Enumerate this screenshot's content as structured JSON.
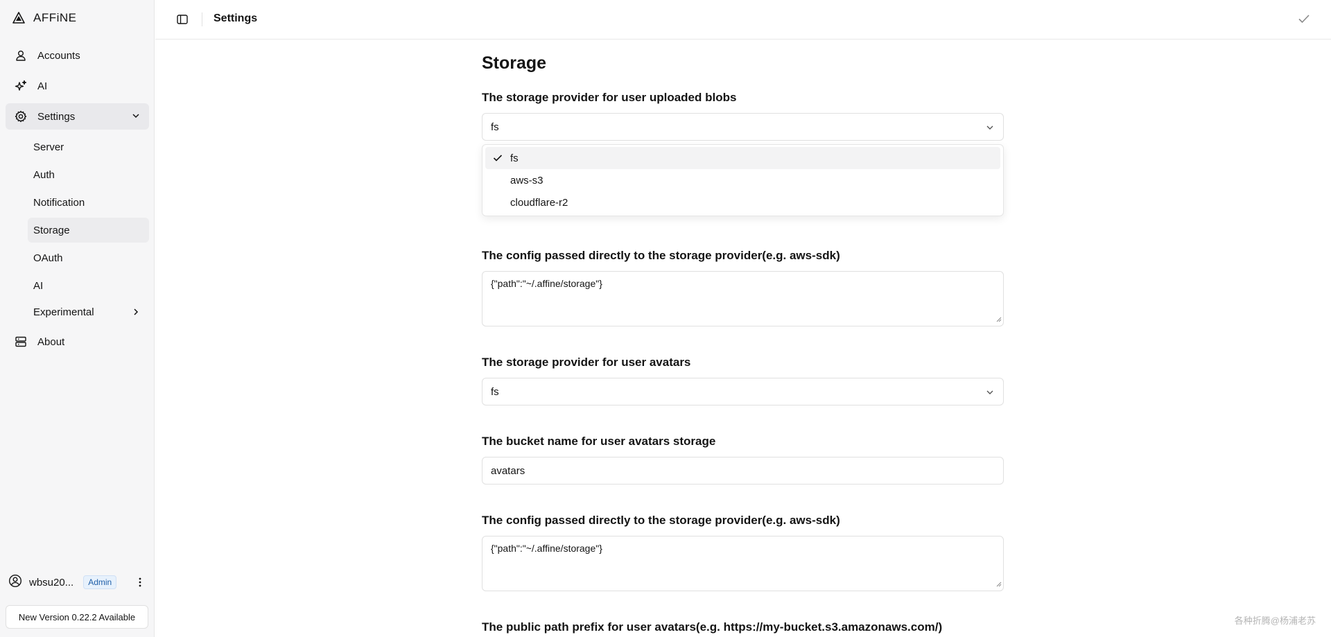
{
  "sidebar": {
    "brand": "AFFiNE",
    "nav": {
      "accounts": "Accounts",
      "ai": "AI",
      "settings": "Settings",
      "about": "About"
    },
    "settings_sub": {
      "server": "Server",
      "auth": "Auth",
      "notification": "Notification",
      "storage": "Storage",
      "oauth": "OAuth",
      "ai": "AI",
      "experimental": "Experimental"
    },
    "user": {
      "name": "wbsu20...",
      "role": "Admin"
    },
    "update_label": "New Version 0.22.2 Available"
  },
  "header": {
    "title": "Settings"
  },
  "main": {
    "title": "Storage",
    "blob_provider": {
      "label": "The storage provider for user uploaded blobs",
      "value": "fs",
      "options": [
        "fs",
        "aws-s3",
        "cloudflare-r2"
      ]
    },
    "blob_config": {
      "label": "The config passed directly to the storage provider(e.g. aws-sdk)",
      "value": "{\"path\":\"~/.affine/storage\"}"
    },
    "avatar_provider": {
      "label": "The storage provider for user avatars",
      "value": "fs"
    },
    "avatar_bucket": {
      "label": "The bucket name for user avatars storage",
      "value": "avatars"
    },
    "avatar_config": {
      "label": "The config passed directly to the storage provider(e.g. aws-sdk)",
      "value": "{\"path\":\"~/.affine/storage\"}"
    },
    "avatar_public_path": {
      "label": "The public path prefix for user avatars(e.g. https://my-bucket.s3.amazonaws.com/)"
    }
  },
  "watermark": "各种折腾@杨浦老苏",
  "icons": {
    "logo": "affine-logo-icon",
    "accounts": "user-icon",
    "ai": "sparkle-icon",
    "settings": "gear-icon",
    "about": "server-icon",
    "sidebar_toggle": "sidebar-toggle-icon",
    "confirm": "check-icon",
    "more": "more-vertical-icon"
  },
  "colors": {
    "sidebar_bg": "#f6f6f7",
    "active_bg": "#e9e9ec",
    "badge_text": "#1f5fa8",
    "badge_bg": "#e7f1fc"
  }
}
